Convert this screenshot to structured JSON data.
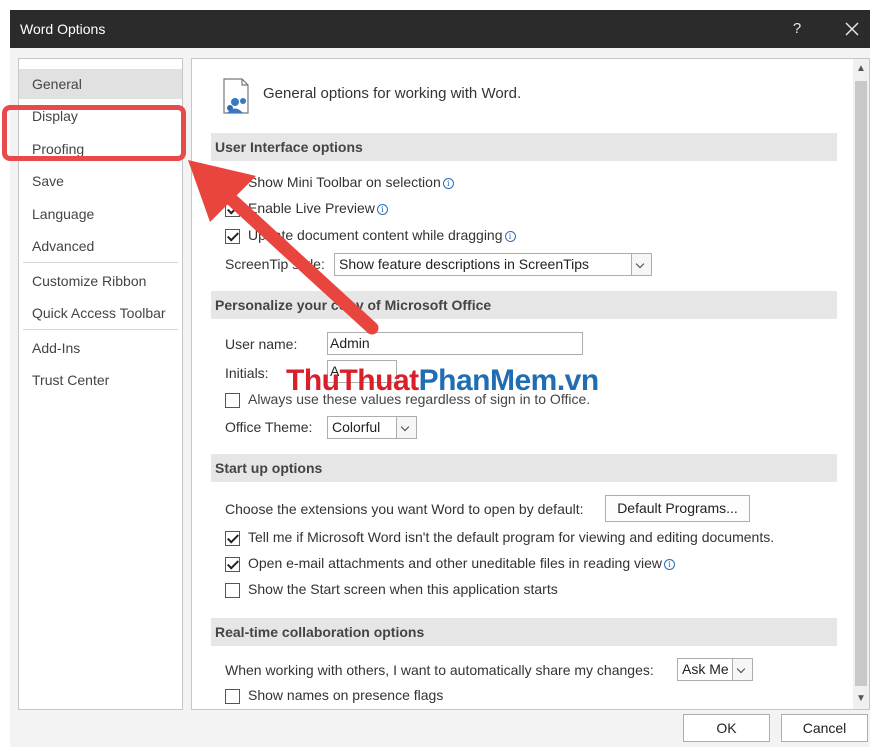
{
  "window": {
    "title": "Word Options",
    "help_label": "?",
    "close_label": "×"
  },
  "nav": {
    "items": [
      {
        "label": "General"
      },
      {
        "label": "Display"
      },
      {
        "label": "Proofing"
      },
      {
        "label": "Save"
      },
      {
        "label": "Language"
      },
      {
        "label": "Advanced"
      },
      {
        "label": "Customize Ribbon"
      },
      {
        "label": "Quick Access Toolbar"
      },
      {
        "label": "Add-Ins"
      },
      {
        "label": "Trust Center"
      }
    ],
    "selected": "General"
  },
  "content": {
    "header": "General options for working with Word.",
    "ui_section": {
      "title": "User Interface options",
      "mini_toolbar": "Show Mini Toolbar on selection",
      "live_preview": "Enable Live Preview",
      "update_content": "Update document content while dragging",
      "screentip_label": "ScreenTip style:",
      "screentip_value": "Show feature descriptions in ScreenTips"
    },
    "personalize_section": {
      "title": "Personalize your copy of Microsoft Office",
      "username_label": "User name:",
      "username_value": "Admin",
      "initials_label": "Initials:",
      "initials_value": "A",
      "always_use_label": "Always use these values regardless of sign in to Office.",
      "theme_label": "Office Theme:",
      "theme_value": "Colorful"
    },
    "startup_section": {
      "title": "Start up options",
      "extensions_text": "Choose the extensions you want Word to open by default:",
      "default_programs_button": "Default Programs...",
      "tell_me": "Tell me if Microsoft Word isn't the default program for viewing and editing documents.",
      "open_email": "Open e-mail attachments and other uneditable files in reading view",
      "show_start": "Show the Start screen when this application starts"
    },
    "collab_section": {
      "title": "Real-time collaboration options",
      "share_text": "When working with others, I want to automatically share my changes:",
      "share_value": "Ask Me",
      "show_names": "Show names on presence flags"
    }
  },
  "footer": {
    "ok_label": "OK",
    "cancel_label": "Cancel"
  },
  "overlay": {
    "watermark_part1": "ThuThuat",
    "watermark_part2": "PhanMem.vn",
    "highlight_color": "#e84a4a"
  },
  "checkbox_states": {
    "mini_toolbar": true,
    "live_preview": true,
    "update_content": true,
    "always_use": false,
    "tell_me": true,
    "open_email": true,
    "show_start": false,
    "show_names": false
  }
}
